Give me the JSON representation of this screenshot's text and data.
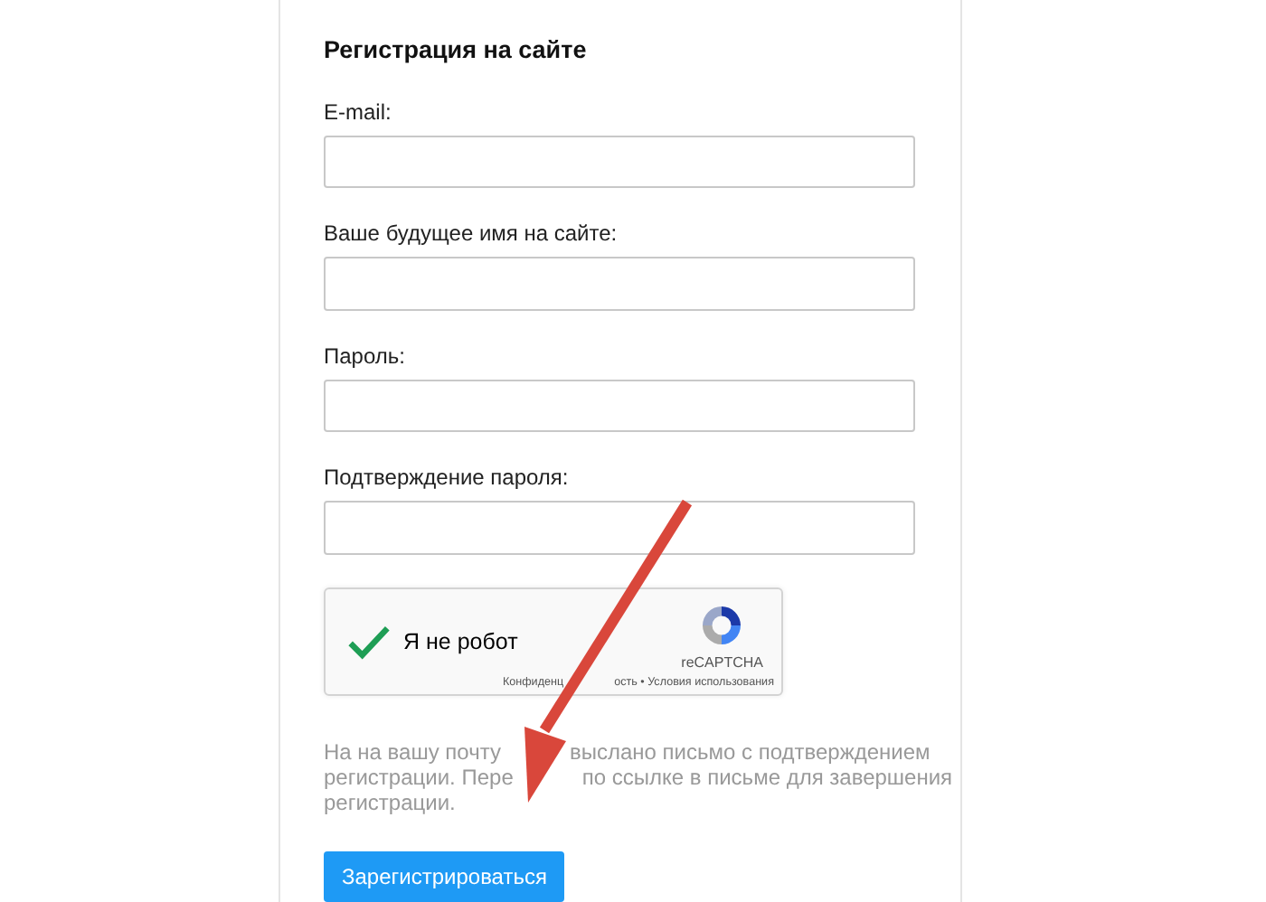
{
  "form": {
    "title": "Регистрация на сайте",
    "fields": [
      {
        "label": "E-mail:"
      },
      {
        "label": "Ваше будущее имя на сайте:"
      },
      {
        "label": "Пароль:"
      },
      {
        "label": "Подтверждение пароля:"
      }
    ],
    "captcha": {
      "checked": true,
      "label": "Я не робот",
      "brand": "reCAPTCHA",
      "links": [
        "Конфиденц",
        "ость • Условия использования"
      ]
    },
    "notice_lines": [
      [
        "На на вашу почту",
        "выслано письмо с подтверждением"
      ],
      [
        "регистрации. Пере",
        "по ссылке в письме для завершения"
      ],
      [
        "регистрации."
      ]
    ],
    "submit": "Зарегистрироваться"
  }
}
